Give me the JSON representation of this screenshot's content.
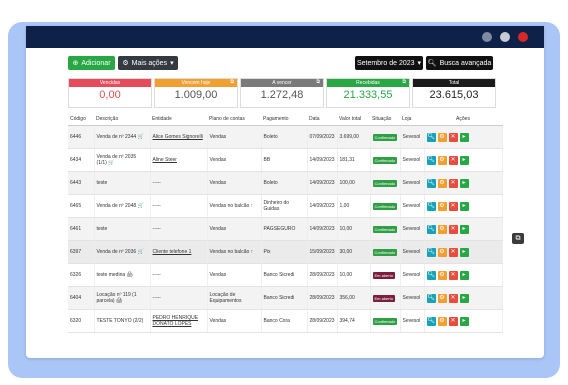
{
  "window": {
    "dots": [
      "#7c8aa3",
      "#c7cbd3",
      "#d6282b"
    ]
  },
  "toolbar": {
    "add_label": "Adicionar",
    "more_actions_label": "Mais ações",
    "period_label": "Setembro de 2023",
    "advanced_search_label": "Busca avançada"
  },
  "cards": [
    {
      "title": "Vencidas",
      "value": "0,00",
      "color": "#e54b5a",
      "value_color": "#d9534f"
    },
    {
      "title": "Vencem hoje",
      "value": "1.009,00",
      "color": "#f0a030",
      "value_color": "#555555"
    },
    {
      "title": "A vencer",
      "value": "1.272,48",
      "color": "#7a7a7a",
      "value_color": "#555555"
    },
    {
      "title": "Recebidas",
      "value": "21.333,55",
      "color": "#27a844",
      "value_color": "#27a844"
    },
    {
      "title": "Total",
      "value": "23.615,03",
      "color": "#1b1b1b",
      "value_color": "#222222"
    }
  ],
  "table": {
    "headers": [
      "Código",
      "Descrição",
      "Entidade",
      "Plano de contas",
      "Pagamento",
      "Data",
      "Valor total",
      "Situação",
      "Loja",
      "Ações"
    ],
    "rows": [
      {
        "code": "6446",
        "desc": "Venda de nº 2344 🛒",
        "entity": "Alice Gomes Signorelli",
        "plan": "Vendas",
        "payment": "Boleto",
        "date": "07/09/2023",
        "total": "3.699,00",
        "status": "Confirmado",
        "store": "Sevesol"
      },
      {
        "code": "6434",
        "desc": "Venda de nº 2035 (1/1) 🛒",
        "entity": "Aline Steer",
        "plan": "Vendas",
        "payment": "BB",
        "date": "14/09/2023",
        "total": "181,31",
        "status": "Confirmado",
        "store": "Sevesol"
      },
      {
        "code": "6443",
        "desc": "teste",
        "entity": "-----",
        "plan": "Vendas",
        "payment": "Boleto",
        "date": "14/09/2023",
        "total": "100,00",
        "status": "Confirmado",
        "store": "Sevesol"
      },
      {
        "code": "6465",
        "desc": "Venda de nº 2048 🛒",
        "entity": "-----",
        "plan": "Vendas no balcão ↑",
        "payment": "Dinheiro do Guidas",
        "date": "14/09/2023",
        "total": "1,00",
        "status": "Confirmado",
        "store": "Sevesol"
      },
      {
        "code": "6461",
        "desc": "teste",
        "entity": "-----",
        "plan": "Vendas",
        "payment": "PAGSEGURO",
        "date": "14/09/2023",
        "total": "10,00",
        "status": "Confirmado",
        "store": "Sevesol"
      },
      {
        "code": "6397",
        "desc": "Venda de nº 2036 🛒",
        "entity": "Cliente telefone 1",
        "plan": "Vendas no balcão ↑",
        "payment": "Pix",
        "date": "15/09/2023",
        "total": "30,00",
        "status": "Confirmado",
        "store": "Sevesol"
      },
      {
        "code": "6326",
        "desc": "teste medina 🖨",
        "entity": "-----",
        "plan": "Vendas",
        "payment": "Banco Sicredi",
        "date": "28/09/2023",
        "total": "10,00",
        "status": "Em aberto",
        "store": "Sevesol"
      },
      {
        "code": "6404",
        "desc": "Locação nº 119 (1 parcela) 🖨",
        "entity": "-----",
        "plan": "Locação de Equipamentos",
        "payment": "Banco Sicredi",
        "date": "28/09/2023",
        "total": "356,00",
        "status": "Em aberto",
        "store": "Sevesol"
      },
      {
        "code": "6320",
        "desc": "TESTE TONYO (2/2)",
        "entity": "PEDRO HENRIQUE DONATO LOPES",
        "plan": "Vendas",
        "payment": "Banco Cora",
        "date": "28/09/2023",
        "total": "394,74",
        "status": "Confirmado",
        "store": "Sevesol"
      }
    ]
  },
  "colors": {
    "green": "#27a844",
    "confirm": "#2f9e44",
    "open": "#7b1f3c",
    "view": "#17a2b8",
    "edit": "#f0a030",
    "delete": "#e74c3c",
    "more": "#28a745"
  },
  "icons": {
    "add": "plus-circle-icon",
    "more": "gears-icon",
    "search": "magnifier-icon",
    "view": "search-icon",
    "edit": "gear-icon",
    "delete": "close-icon",
    "expand": "caret-icon",
    "tooltip": "tooltip-icon"
  }
}
